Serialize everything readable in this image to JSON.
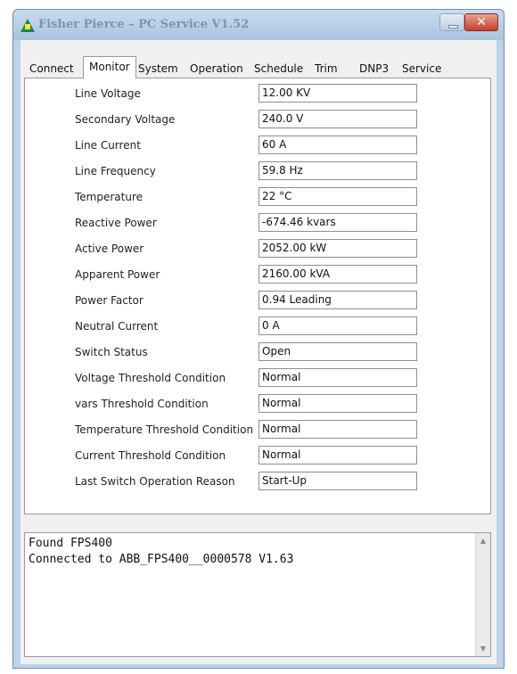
{
  "window": {
    "title": "Fisher Pierce – PC Service V1.52"
  },
  "tabs": [
    "Connect",
    "Monitor",
    "System",
    "Operation",
    "Schedule",
    "Trim",
    "DNP3",
    "Service"
  ],
  "active_tab": "Monitor",
  "fields": [
    {
      "label": "Line Voltage",
      "value": "12.00 KV"
    },
    {
      "label": "Secondary Voltage",
      "value": "240.0 V"
    },
    {
      "label": "Line Current",
      "value": "60 A"
    },
    {
      "label": "Line Frequency",
      "value": "59.8 Hz"
    },
    {
      "label": "Temperature",
      "value": "22 °C"
    },
    {
      "label": "Reactive Power",
      "value": "-674.46 kvars"
    },
    {
      "label": "Active Power",
      "value": "2052.00 kW"
    },
    {
      "label": "Apparent Power",
      "value": "2160.00 kVA"
    },
    {
      "label": "Power Factor",
      "value": "0.94 Leading"
    },
    {
      "label": "Neutral Current",
      "value": "0 A"
    },
    {
      "label": "Switch Status",
      "value": "Open"
    },
    {
      "label": "Voltage Threshold Condition",
      "value": "Normal"
    },
    {
      "label": "vars Threshold Condition",
      "value": "Normal"
    },
    {
      "label": "Temperature Threshold Condition",
      "value": "Normal"
    },
    {
      "label": "Current Threshold Condition",
      "value": "Normal"
    },
    {
      "label": "Last Switch Operation Reason",
      "value": "Start-Up"
    }
  ],
  "log": [
    "Found FPS400",
    "Connected to ABB_FPS400__0000578 V1.63"
  ]
}
